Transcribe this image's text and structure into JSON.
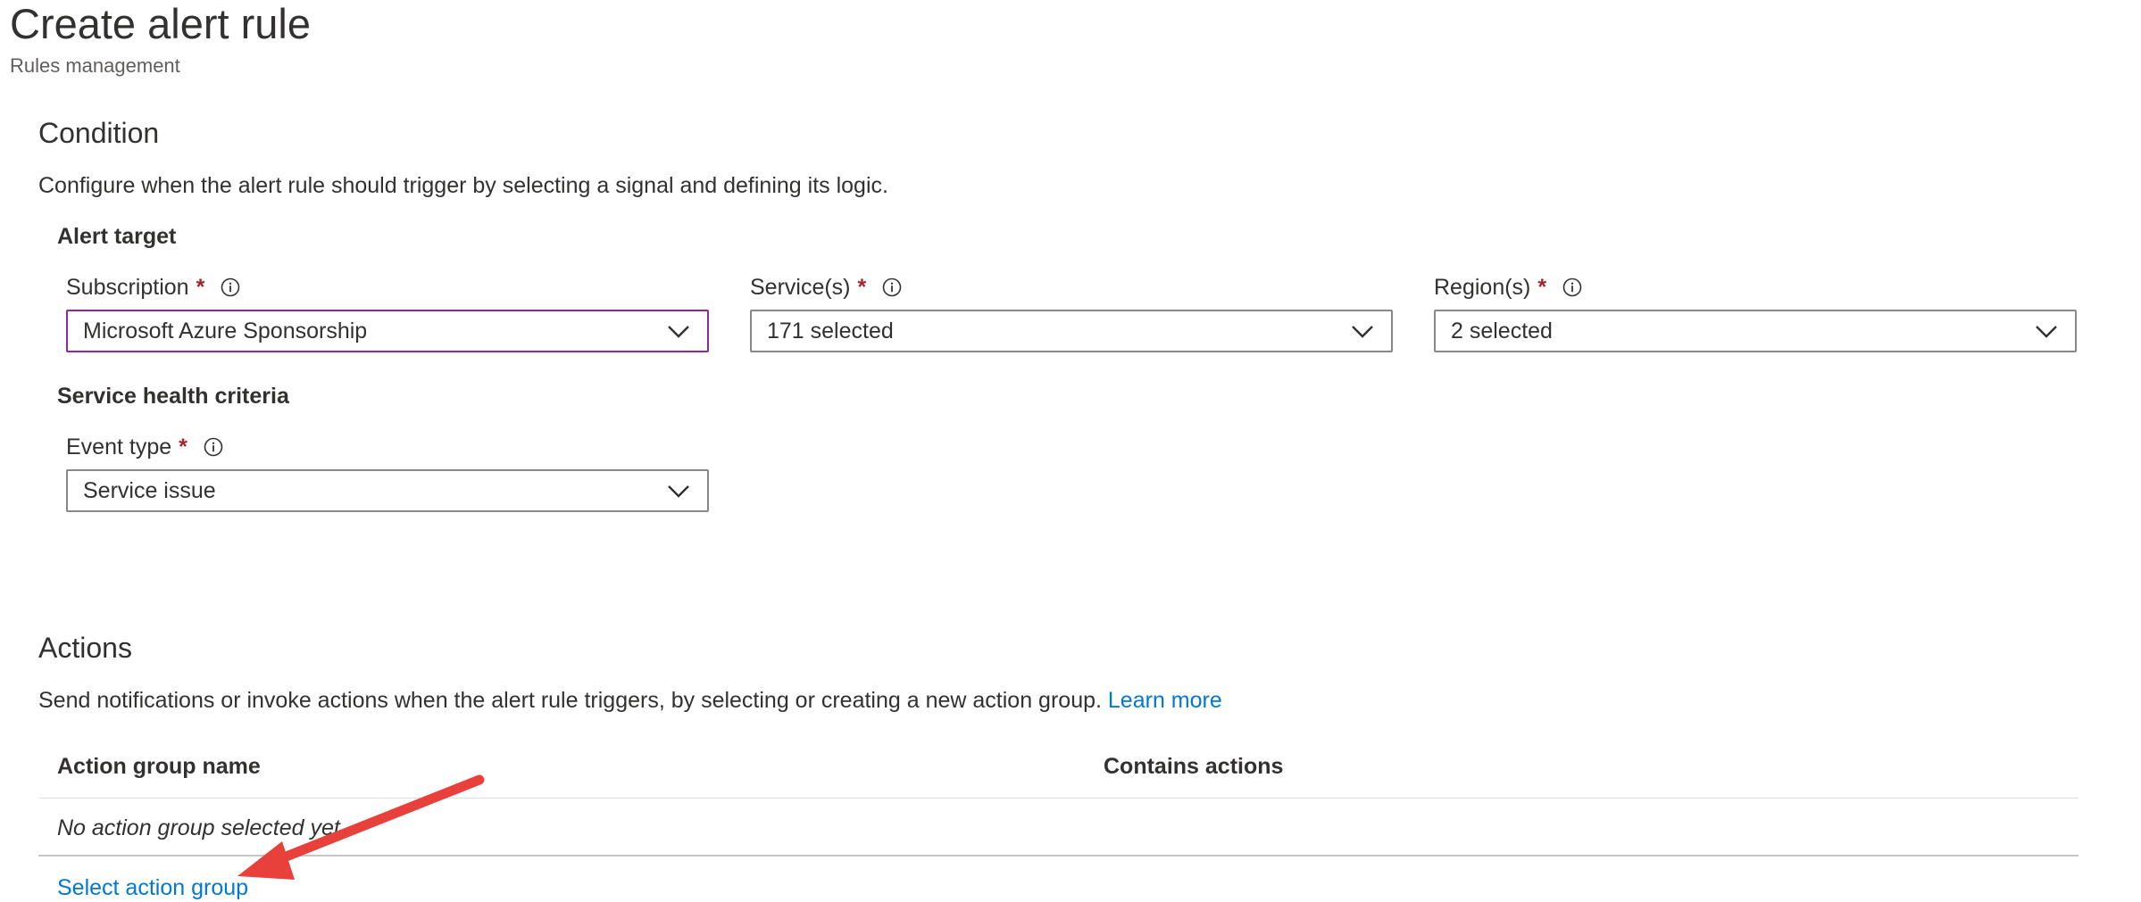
{
  "header": {
    "title": "Create alert rule",
    "subtitle": "Rules management"
  },
  "condition": {
    "title": "Condition",
    "description": "Configure when the alert rule should trigger by selecting a signal and defining its logic.",
    "alert_target": {
      "heading": "Alert target",
      "subscription": {
        "label": "Subscription",
        "required": "*",
        "value": "Microsoft Azure Sponsorship"
      },
      "services": {
        "label": "Service(s)",
        "required": "*",
        "value": "171 selected"
      },
      "regions": {
        "label": "Region(s)",
        "required": "*",
        "value": "2 selected"
      }
    },
    "service_health": {
      "heading": "Service health criteria",
      "event_type": {
        "label": "Event type",
        "required": "*",
        "value": "Service issue"
      }
    }
  },
  "actions": {
    "title": "Actions",
    "description": "Send notifications or invoke actions when the alert rule triggers, by selecting or creating a new action group.",
    "learn_more": "Learn more",
    "table": {
      "columns": [
        "Action group name",
        "Contains actions"
      ],
      "empty_text": "No action group selected yet"
    },
    "select_link": "Select action group"
  },
  "icons": {
    "info": "info-icon",
    "chevron": "chevron-down-icon"
  },
  "colors": {
    "accent_link": "#0078d4",
    "required": "#a4262c",
    "focus_border": "#8a2a9e",
    "annotation_arrow": "#e8413c"
  }
}
